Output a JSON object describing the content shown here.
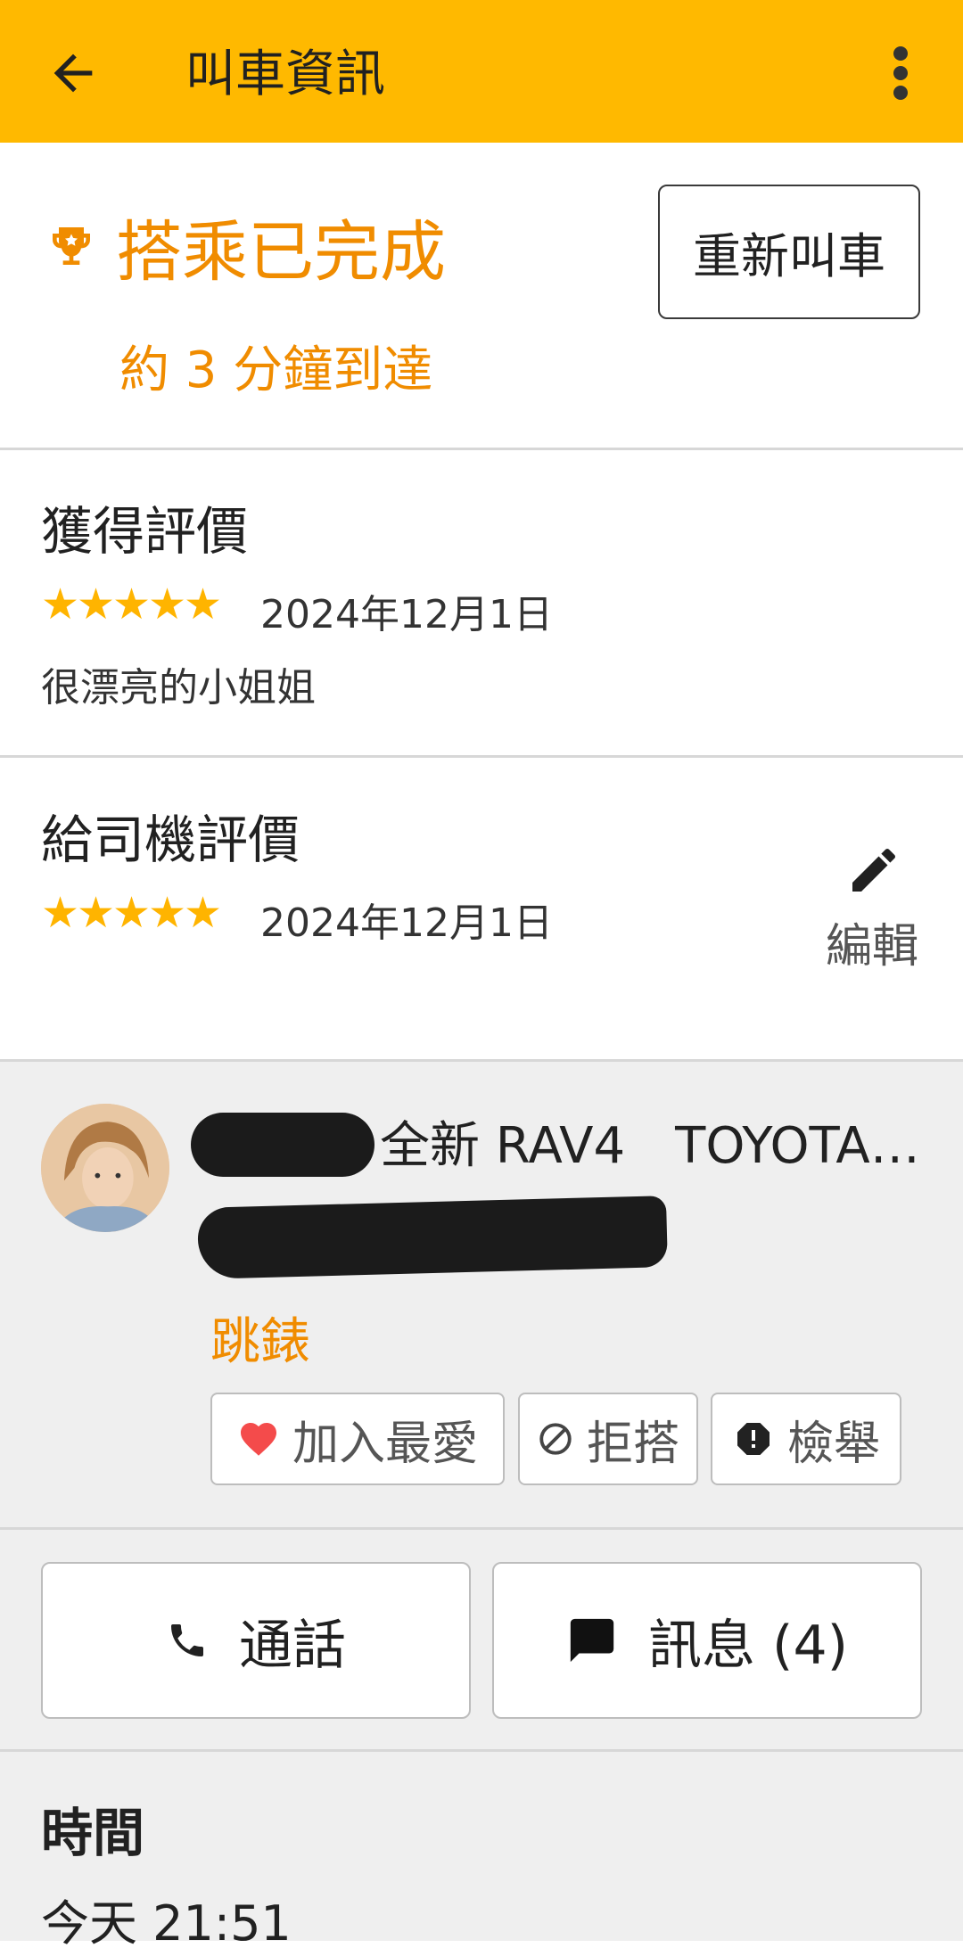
{
  "app_bar": {
    "title": "叫車資訊",
    "bg": "#FFB900"
  },
  "trip": {
    "status": "搭乘已完成",
    "eta": "約 3 分鐘到達",
    "rebook_label": "重新叫車",
    "status_color": "#F08C00"
  },
  "received_rating": {
    "heading": "獲得評價",
    "stars": 5,
    "date": "2024年12月1日",
    "comment": "很漂亮的小姐姐"
  },
  "driver_rating": {
    "heading": "給司機評價",
    "stars": 5,
    "date": "2024年12月1日",
    "edit_label": "編輯"
  },
  "driver": {
    "car": "全新 RAV4　TOYOTA…",
    "link_label": "跳錶",
    "actions": {
      "favorite": "加入最愛",
      "block": "拒搭",
      "report": "檢舉"
    }
  },
  "contact": {
    "call_label": "通話",
    "message_label": "訊息 (4)"
  },
  "time": {
    "heading": "時間",
    "value": "今天 21:51"
  },
  "icons": [
    "back-arrow-icon",
    "more-vert-icon",
    "trophy-icon",
    "star-icon",
    "pencil-icon",
    "heart-icon",
    "block-icon",
    "report-icon",
    "phone-icon",
    "chat-icon"
  ]
}
